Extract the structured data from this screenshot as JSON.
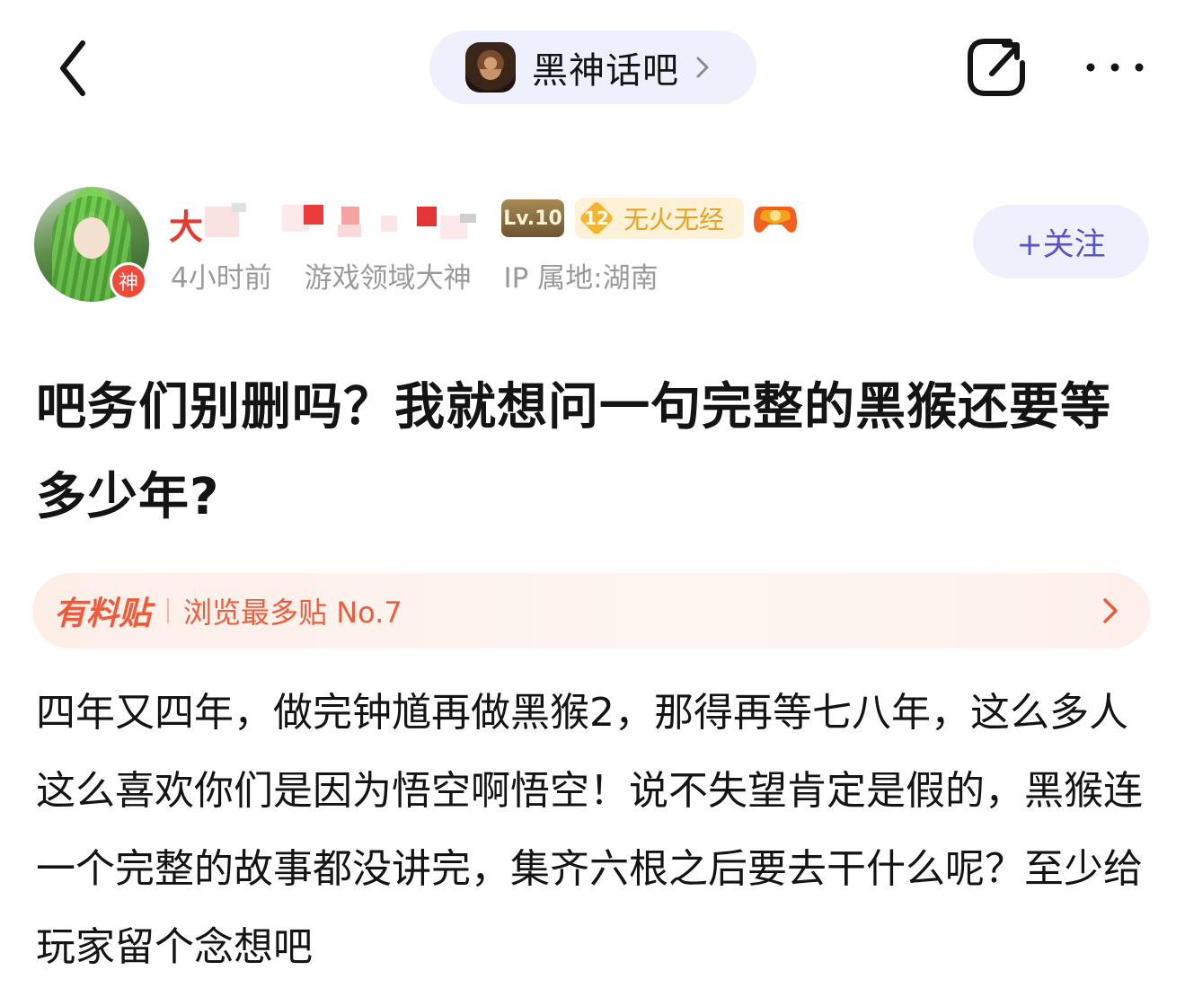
{
  "header": {
    "forum_name": "黑神话吧",
    "back_icon": "chevron-left-icon",
    "edit_icon": "edit-share-icon",
    "more_icon": "more-dots-icon"
  },
  "author": {
    "name": "大",
    "level": "Lv.10",
    "fire_level": "12",
    "fire_label": "无火无经",
    "avatar_badge": "神",
    "time": "4小时前",
    "title": "游戏领域大神",
    "location": "IP 属地:湖南",
    "follow_label": "+关注"
  },
  "post": {
    "title": "吧务们别删吗？我就想问一句完整的黑猴还要等多少年?",
    "banner_tag": "有料贴",
    "banner_text": "浏览最多贴 No.7",
    "body": "四年又四年，做完钟馗再做黑猴2，那得再等七八年，这么多人这么喜欢你们是因为悟空啊悟空！说不失望肯定是假的，黑猴连一个完整的故事都没讲完，集齐六根之后要去干什么呢？至少给玩家留个念想吧"
  },
  "colors": {
    "accent_purple": "#5a53c8",
    "name_red": "#e53a2f",
    "banner_orange": "#ef5c3d",
    "pill_bg": "#eef0fb"
  }
}
